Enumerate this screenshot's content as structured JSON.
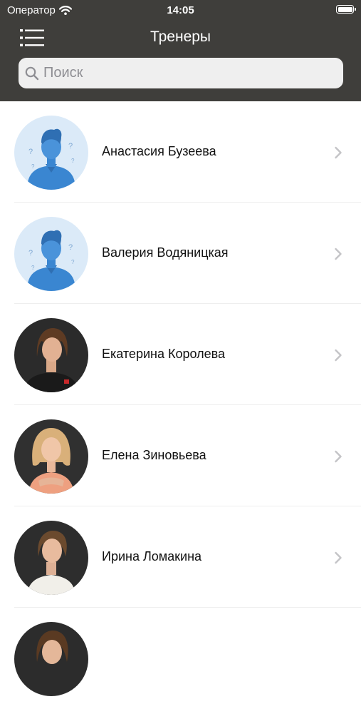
{
  "status_bar": {
    "carrier": "Оператор",
    "time": "14:05",
    "wifi_icon": "wifi-icon",
    "battery_icon": "battery-icon"
  },
  "nav": {
    "title": "Тренеры",
    "menu_icon": "menu-icon"
  },
  "search": {
    "placeholder": "Поиск",
    "value": "",
    "icon": "search-icon"
  },
  "trainers": [
    {
      "name": "Анастасия Бузеева",
      "photo": "placeholder"
    },
    {
      "name": "Валерия Водяницкая",
      "photo": "placeholder"
    },
    {
      "name": "Екатерина Королева",
      "photo": "photo"
    },
    {
      "name": "Елена Зиновьева",
      "photo": "photo"
    },
    {
      "name": "Ирина Ломакина",
      "photo": "photo"
    },
    {
      "name": "",
      "photo": "photo"
    }
  ],
  "colors": {
    "header_bg": "#3f3e3b",
    "search_bg": "#efefef",
    "placeholder_avatar_bg": "#dbeaf8",
    "placeholder_avatar_figure": "#3a86d1",
    "chevron": "#c4c4c7"
  }
}
